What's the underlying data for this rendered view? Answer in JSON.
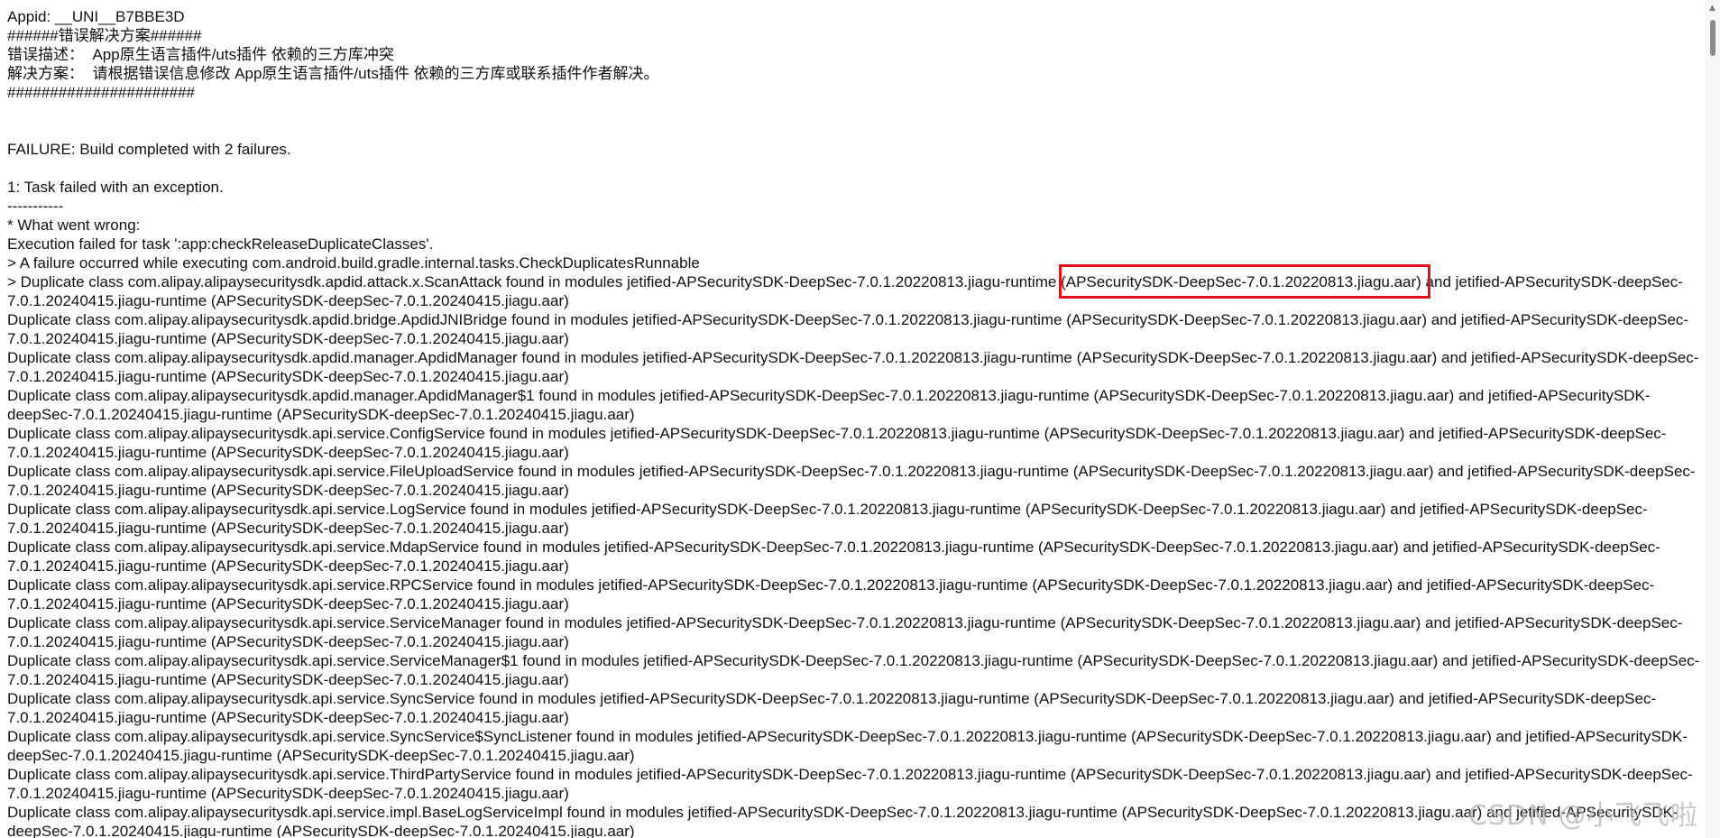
{
  "header": {
    "appid": "Appid: __UNI__B7BBE3D",
    "banner_start": "######错误解决方案######",
    "error_desc": "错误描述：  App原生语言插件/uts插件 依赖的三方库冲突",
    "solution": "解决方案：  请根据错误信息修改 App原生语言插件/uts插件 依赖的三方库或联系插件作者解决。",
    "banner_end": "######################"
  },
  "build": {
    "failure": "FAILURE: Build completed with 2 failures.",
    "task_failed": "1: Task failed with an exception.",
    "separator": "-----------",
    "what_wrong": "* What went wrong:",
    "execution_failed": "Execution failed for task ':app:checkReleaseDuplicateClasses'.",
    "failure_occurred": "> A failure occurred while executing com.android.build.gradle.internal.tasks.CheckDuplicatesRunnable"
  },
  "duplicate_lines": [
    "> Duplicate class com.alipay.alipaysecuritysdk.apdid.attack.x.ScanAttack found in modules jetified-APSecuritySDK-DeepSec-7.0.1.20220813.jiagu-runtime (APSecuritySDK-DeepSec-7.0.1.20220813.jiagu.aar) and jetified-APSecuritySDK-deepSec-",
    "7.0.1.20240415.jiagu-runtime (APSecuritySDK-deepSec-7.0.1.20240415.jiagu.aar)",
    "Duplicate class com.alipay.alipaysecuritysdk.apdid.bridge.ApdidJNIBridge found in modules jetified-APSecuritySDK-DeepSec-7.0.1.20220813.jiagu-runtime (APSecuritySDK-DeepSec-7.0.1.20220813.jiagu.aar) and jetified-APSecuritySDK-deepSec-",
    "7.0.1.20240415.jiagu-runtime (APSecuritySDK-deepSec-7.0.1.20240415.jiagu.aar)",
    "Duplicate class com.alipay.alipaysecuritysdk.apdid.manager.ApdidManager found in modules jetified-APSecuritySDK-DeepSec-7.0.1.20220813.jiagu-runtime (APSecuritySDK-DeepSec-7.0.1.20220813.jiagu.aar) and jetified-APSecuritySDK-deepSec-",
    "7.0.1.20240415.jiagu-runtime (APSecuritySDK-deepSec-7.0.1.20240415.jiagu.aar)",
    "Duplicate class com.alipay.alipaysecuritysdk.apdid.manager.ApdidManager$1 found in modules jetified-APSecuritySDK-DeepSec-7.0.1.20220813.jiagu-runtime (APSecuritySDK-DeepSec-7.0.1.20220813.jiagu.aar) and jetified-APSecuritySDK-",
    "deepSec-7.0.1.20240415.jiagu-runtime (APSecuritySDK-deepSec-7.0.1.20240415.jiagu.aar)",
    "Duplicate class com.alipay.alipaysecuritysdk.api.service.ConfigService found in modules jetified-APSecuritySDK-DeepSec-7.0.1.20220813.jiagu-runtime (APSecuritySDK-DeepSec-7.0.1.20220813.jiagu.aar) and jetified-APSecuritySDK-deepSec-",
    "7.0.1.20240415.jiagu-runtime (APSecuritySDK-deepSec-7.0.1.20240415.jiagu.aar)",
    "Duplicate class com.alipay.alipaysecuritysdk.api.service.FileUploadService found in modules jetified-APSecuritySDK-DeepSec-7.0.1.20220813.jiagu-runtime (APSecuritySDK-DeepSec-7.0.1.20220813.jiagu.aar) and jetified-APSecuritySDK-deepSec-",
    "7.0.1.20240415.jiagu-runtime (APSecuritySDK-deepSec-7.0.1.20240415.jiagu.aar)",
    "Duplicate class com.alipay.alipaysecuritysdk.api.service.LogService found in modules jetified-APSecuritySDK-DeepSec-7.0.1.20220813.jiagu-runtime (APSecuritySDK-DeepSec-7.0.1.20220813.jiagu.aar) and jetified-APSecuritySDK-deepSec-",
    "7.0.1.20240415.jiagu-runtime (APSecuritySDK-deepSec-7.0.1.20240415.jiagu.aar)",
    "Duplicate class com.alipay.alipaysecuritysdk.api.service.MdapService found in modules jetified-APSecuritySDK-DeepSec-7.0.1.20220813.jiagu-runtime (APSecuritySDK-DeepSec-7.0.1.20220813.jiagu.aar) and jetified-APSecuritySDK-deepSec-",
    "7.0.1.20240415.jiagu-runtime (APSecuritySDK-deepSec-7.0.1.20240415.jiagu.aar)",
    "Duplicate class com.alipay.alipaysecuritysdk.api.service.RPCService found in modules jetified-APSecuritySDK-DeepSec-7.0.1.20220813.jiagu-runtime (APSecuritySDK-DeepSec-7.0.1.20220813.jiagu.aar) and jetified-APSecuritySDK-deepSec-",
    "7.0.1.20240415.jiagu-runtime (APSecuritySDK-deepSec-7.0.1.20240415.jiagu.aar)",
    "Duplicate class com.alipay.alipaysecuritysdk.api.service.ServiceManager found in modules jetified-APSecuritySDK-DeepSec-7.0.1.20220813.jiagu-runtime (APSecuritySDK-DeepSec-7.0.1.20220813.jiagu.aar) and jetified-APSecuritySDK-deepSec-",
    "7.0.1.20240415.jiagu-runtime (APSecuritySDK-deepSec-7.0.1.20240415.jiagu.aar)",
    "Duplicate class com.alipay.alipaysecuritysdk.api.service.ServiceManager$1 found in modules jetified-APSecuritySDK-DeepSec-7.0.1.20220813.jiagu-runtime (APSecuritySDK-DeepSec-7.0.1.20220813.jiagu.aar) and jetified-APSecuritySDK-deepSec-",
    "7.0.1.20240415.jiagu-runtime (APSecuritySDK-deepSec-7.0.1.20240415.jiagu.aar)",
    "Duplicate class com.alipay.alipaysecuritysdk.api.service.SyncService found in modules jetified-APSecuritySDK-DeepSec-7.0.1.20220813.jiagu-runtime (APSecuritySDK-DeepSec-7.0.1.20220813.jiagu.aar) and jetified-APSecuritySDK-deepSec-",
    "7.0.1.20240415.jiagu-runtime (APSecuritySDK-deepSec-7.0.1.20240415.jiagu.aar)",
    "Duplicate class com.alipay.alipaysecuritysdk.api.service.SyncService$SyncListener found in modules jetified-APSecuritySDK-DeepSec-7.0.1.20220813.jiagu-runtime (APSecuritySDK-DeepSec-7.0.1.20220813.jiagu.aar) and jetified-APSecuritySDK-",
    "deepSec-7.0.1.20240415.jiagu-runtime (APSecuritySDK-deepSec-7.0.1.20240415.jiagu.aar)",
    "Duplicate class com.alipay.alipaysecuritysdk.api.service.ThirdPartyService found in modules jetified-APSecuritySDK-DeepSec-7.0.1.20220813.jiagu-runtime (APSecuritySDK-DeepSec-7.0.1.20220813.jiagu.aar) and jetified-APSecuritySDK-deepSec-",
    "7.0.1.20240415.jiagu-runtime (APSecuritySDK-deepSec-7.0.1.20240415.jiagu.aar)",
    "Duplicate class com.alipay.alipaysecuritysdk.api.service.impl.BaseLogServiceImpl found in modules jetified-APSecuritySDK-DeepSec-7.0.1.20220813.jiagu-runtime (APSecuritySDK-DeepSec-7.0.1.20220813.jiagu.aar) and jetified-APSecuritySDK-",
    "deepSec-7.0.1.20240415.jiagu-runtime (APSecuritySDK-deepSec-7.0.1.20240415.jiagu.aar)"
  ],
  "highlight_color": "#e0121a",
  "watermark": "CSDN @小飞飞啦",
  "icons": {
    "scroll_up": "scroll-up-arrow-icon"
  }
}
